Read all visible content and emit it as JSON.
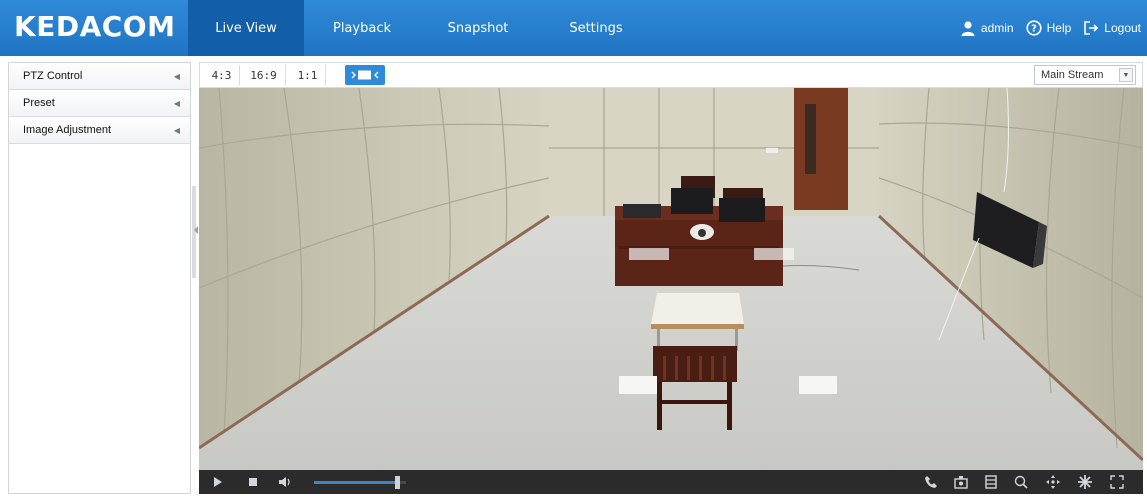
{
  "app": {
    "logo": "KEDACOM",
    "brand_color": "#1f74c2"
  },
  "nav": {
    "tabs": [
      {
        "label": "Live View",
        "active": true
      },
      {
        "label": "Playback",
        "active": false
      },
      {
        "label": "Snapshot",
        "active": false
      },
      {
        "label": "Settings",
        "active": false
      }
    ]
  },
  "user": {
    "name": "admin",
    "help_label": "Help",
    "logout_label": "Logout"
  },
  "sidebar": {
    "items": [
      {
        "label": "PTZ Control"
      },
      {
        "label": "Preset"
      },
      {
        "label": "Image Adjustment"
      }
    ]
  },
  "toolbar": {
    "ratios": [
      "4:3",
      "16:9",
      "1:1"
    ],
    "fit_icon": "fit-window-icon",
    "stream": {
      "selected": "Main Stream"
    }
  },
  "player": {
    "icons": [
      "play-icon",
      "stop-icon",
      "volume-icon",
      "talk-icon",
      "snapshot-icon",
      "record-icon",
      "zoom-icon",
      "ptz-icon",
      "settings-icon",
      "fullscreen-icon"
    ],
    "volume_percent": 90
  }
}
